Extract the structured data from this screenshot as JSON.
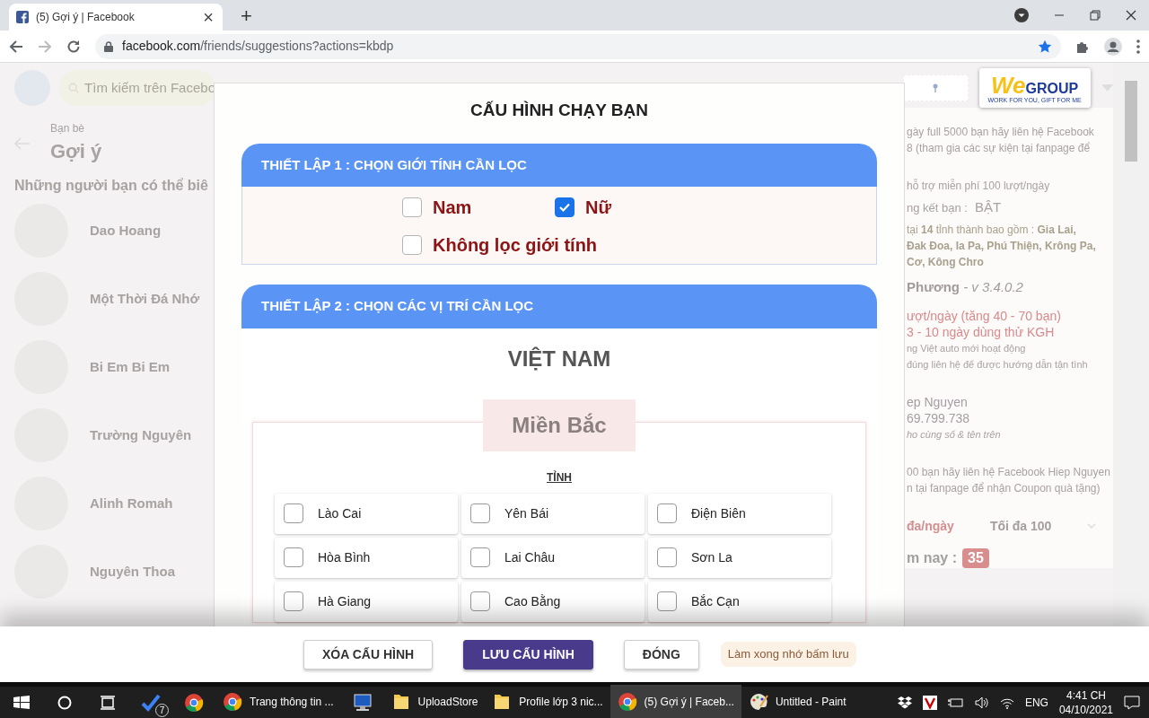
{
  "browser": {
    "tab_title": "(5) Gợi ý | Facebook",
    "tab_close": "×",
    "new_tab": "+",
    "url_host": "facebook.com",
    "url_path": "/friends/suggestions?actions=kbdp"
  },
  "facebook": {
    "search_placeholder": "Tìm kiếm trên Facebo",
    "breadcrumb": "Bạn bè",
    "heading": "Gợi ý",
    "subheading": "Những người bạn có thể biê",
    "people": [
      {
        "name": "Dao Hoang"
      },
      {
        "name": "Một Thời Đá Nhớ"
      },
      {
        "name": "Bi Em Bi Em"
      },
      {
        "name": "Trường Nguyên"
      },
      {
        "name": "Alinh Romah"
      },
      {
        "name": "Nguyên Thoa"
      }
    ]
  },
  "extension": {
    "logo": {
      "mark": "We",
      "text": "GROUP",
      "tagline": "WORK FOR YOU, GIFT FOR ME"
    },
    "lines": [
      {
        "kind": "note",
        "text": "gày full 5000 bạn hãy liên hệ Facebook"
      },
      {
        "kind": "note",
        "text": "8 (tham gia các sự kiện tại fanpage để"
      },
      {
        "kind": "gap"
      },
      {
        "kind": "note",
        "text": "hỗ trợ miễn phí 100 lượt/ngày"
      },
      {
        "kind": "status",
        "text": "ng kết bạn :",
        "value": "BẬT"
      },
      {
        "kind": "bold",
        "text": "tại **14** tỉnh thành bao gồm : **Gia Lai,**"
      },
      {
        "kind": "bold",
        "text": "**Đak Đoa, Ia Pa, Phú Thiện, Krông Pa,**"
      },
      {
        "kind": "bold",
        "text": "**Cơ, Kông Chro**"
      },
      {
        "kind": "version",
        "text": "**Phương** *- v 3.4.0.2*"
      },
      {
        "kind": "red",
        "text": "ượt/ngày (tăng 40 - 70 bạn)"
      },
      {
        "kind": "red",
        "text": "3 - 10 ngày dùng thử KGH"
      },
      {
        "kind": "small",
        "text": "ng Việt auto mới hoạt động"
      },
      {
        "kind": "small",
        "text": "đúng liên hệ để được hướng dẫn tận tình"
      },
      {
        "kind": "gap"
      },
      {
        "kind": "name",
        "text": "ep Nguyen"
      },
      {
        "kind": "name",
        "text": "69.799.738"
      },
      {
        "kind": "italic",
        "text": "ho cùng số & tên trên"
      },
      {
        "kind": "gap"
      },
      {
        "kind": "note",
        "text": "00 bạn hãy liên hệ Facebook Hiep Nguyen"
      },
      {
        "kind": "note",
        "text": "n tại fanpage để nhận Coupon quà tặng)"
      },
      {
        "kind": "select",
        "text": "đa/ngày",
        "value": "Tối đa 100"
      },
      {
        "kind": "counter",
        "text": "m nay :",
        "value": "35"
      }
    ]
  },
  "modal": {
    "title": "CẤU HÌNH CHẠY BẠN",
    "section_1": {
      "title": "THIẾT LẬP 1 : CHỌN GIỚI TÍNH CẦN LỌC",
      "options": [
        {
          "label": "Nam",
          "checked": false
        },
        {
          "label": "Nữ",
          "checked": true
        },
        {
          "label": "Không lọc giới tính",
          "checked": false
        }
      ]
    },
    "section_2": {
      "title": "THIẾT LẬP 2 : CHỌN CÁC VỊ TRÍ CẦN LỌC",
      "country": "VIỆT NAM",
      "region": "Miền Bắc",
      "column_label": "TỈNH",
      "provinces": [
        {
          "label": "Lào Cai",
          "checked": false
        },
        {
          "label": "Yên Bái",
          "checked": false
        },
        {
          "label": "Điện Biên",
          "checked": false
        },
        {
          "label": "Hòa Bình",
          "checked": false
        },
        {
          "label": "Lai Châu",
          "checked": false
        },
        {
          "label": "Sơn La",
          "checked": false
        },
        {
          "label": "Hà Giang",
          "checked": false
        },
        {
          "label": "Cao Bằng",
          "checked": false
        },
        {
          "label": "Bắc Cạn",
          "checked": false
        }
      ]
    },
    "buttons": [
      {
        "kind": "secondary",
        "label": "XÓA CẤU HÌNH"
      },
      {
        "kind": "primary",
        "label": "LƯU CẤU HÌNH"
      },
      {
        "kind": "secondary",
        "label": "ĐÓNG"
      }
    ],
    "hint": "Làm xong nhớ bấm lưu"
  },
  "taskbar": {
    "apps": [
      {
        "kind": "todo",
        "badge": "7",
        "selected": false
      },
      {
        "kind": "chrome",
        "selected": false
      },
      {
        "kind": "chrome",
        "label": "Trang thông tin ...",
        "selected": false
      },
      {
        "kind": "remote",
        "selected": false
      },
      {
        "kind": "folder",
        "label": "UploadStore",
        "selected": false
      },
      {
        "kind": "folder",
        "label": "Profile lớp 3 nic...",
        "selected": false
      },
      {
        "kind": "chrome",
        "label": "(5) Gợi ý | Faceb...",
        "selected": true
      },
      {
        "kind": "paint",
        "label": "Untitled - Paint",
        "selected": false
      }
    ],
    "language": "ENG",
    "time": "4:41 CH",
    "date": "04/10/2021"
  }
}
